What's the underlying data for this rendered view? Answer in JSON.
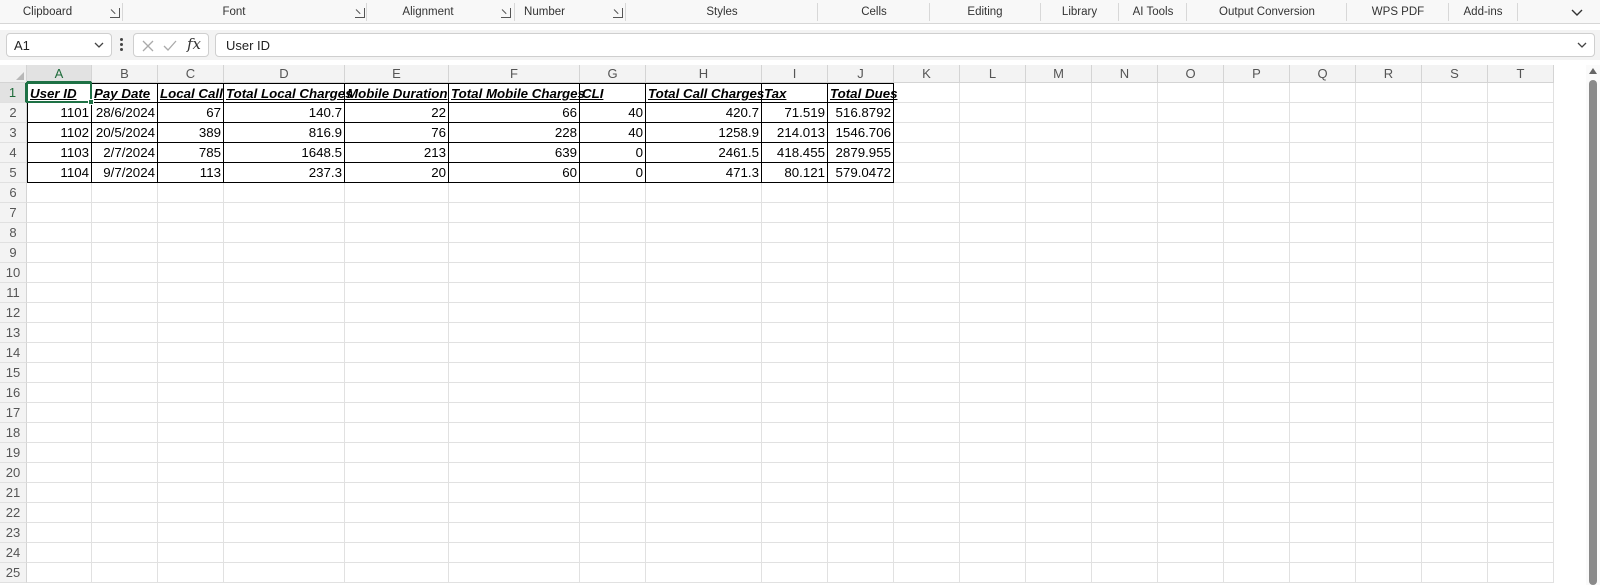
{
  "ribbon": {
    "groups": [
      {
        "label": "Clipboard",
        "launcher": true
      },
      {
        "label": "Font",
        "launcher": true
      },
      {
        "label": "Alignment",
        "launcher": true
      },
      {
        "label": "Number",
        "launcher": true
      },
      {
        "label": "Styles",
        "launcher": false
      },
      {
        "label": "Cells",
        "launcher": false
      },
      {
        "label": "Editing",
        "launcher": false
      },
      {
        "label": "Library",
        "launcher": false
      },
      {
        "label": "AI Tools",
        "launcher": false
      },
      {
        "label": "Output Conversion",
        "launcher": false
      },
      {
        "label": "WPS PDF",
        "launcher": false
      },
      {
        "label": "Add-ins",
        "launcher": false
      }
    ],
    "collapse_icon": "chevron-down-icon"
  },
  "formula_bar": {
    "name_box": "A1",
    "formula": "User ID",
    "fx_label": "fx",
    "icons": [
      "more-vertical-icon",
      "cancel-icon",
      "enter-icon",
      "function-icon",
      "chevron-down-icon"
    ]
  },
  "grid": {
    "columns": [
      "A",
      "B",
      "C",
      "D",
      "E",
      "F",
      "G",
      "H",
      "I",
      "J",
      "K",
      "L",
      "M",
      "N",
      "O",
      "P",
      "Q",
      "R",
      "S",
      "T"
    ],
    "rows": [
      "1",
      "2",
      "3",
      "4",
      "5",
      "6",
      "7",
      "8",
      "9",
      "10",
      "11",
      "12",
      "13",
      "14",
      "15",
      "16",
      "17",
      "18",
      "19",
      "20",
      "21",
      "22",
      "23",
      "24",
      "25"
    ],
    "active_cell": "A1",
    "headers": [
      "User ID",
      "Pay Date",
      "Local Call",
      "Total Local Charges",
      "Mobile Duration",
      "Total Mobile Charges",
      "CLI",
      "Total Call Charges",
      "Tax",
      "Total Dues"
    ],
    "data": [
      [
        "1101",
        "28/6/2024",
        "67",
        "140.7",
        "22",
        "66",
        "40",
        "420.7",
        "71.519",
        "516.8792"
      ],
      [
        "1102",
        "20/5/2024",
        "389",
        "816.9",
        "76",
        "228",
        "40",
        "1258.9",
        "214.013",
        "1546.706"
      ],
      [
        "1103",
        "2/7/2024",
        "785",
        "1648.5",
        "213",
        "639",
        "0",
        "2461.5",
        "418.455",
        "2879.955"
      ],
      [
        "1104",
        "9/7/2024",
        "113",
        "237.3",
        "20",
        "60",
        "0",
        "471.3",
        "80.121",
        "579.0472"
      ]
    ],
    "colors": {
      "selection": "#1e7145",
      "gridline": "#e1e1e1",
      "header_bg": "#f3f3f3"
    }
  }
}
